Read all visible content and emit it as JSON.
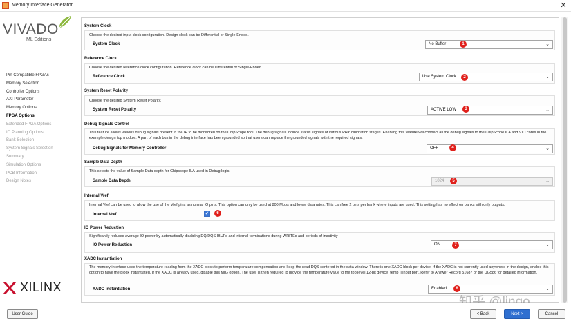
{
  "window": {
    "title": "Memory Interface Generator",
    "close_glyph": "✕"
  },
  "brand": {
    "product": "VIVADO",
    "edition": "ML Editions",
    "vendor": "XILINX"
  },
  "steps": [
    {
      "label": "Pin Compatible FPGAs",
      "state": "done"
    },
    {
      "label": "Memory Selection",
      "state": "done"
    },
    {
      "label": "Controller Options",
      "state": "done"
    },
    {
      "label": "AXI Parameter",
      "state": "done"
    },
    {
      "label": "Memory Options",
      "state": "done"
    },
    {
      "label": "FPGA Options",
      "state": "current"
    },
    {
      "label": "Extended FPGA Options",
      "state": "future"
    },
    {
      "label": "IO Planning Options",
      "state": "future"
    },
    {
      "label": "Bank Selection",
      "state": "future"
    },
    {
      "label": "System Signals Selection",
      "state": "future"
    },
    {
      "label": "Summary",
      "state": "future"
    },
    {
      "label": "Simulation Options",
      "state": "future"
    },
    {
      "label": "PCB Information",
      "state": "future"
    },
    {
      "label": "Design Notes",
      "state": "future"
    }
  ],
  "sections": {
    "system_clock": {
      "title": "System Clock",
      "desc": "Choose the desired input clock configuration. Design clock can be Differential or Single-Ended.",
      "label": "System Clock",
      "value": "No Buffer",
      "badge": "1"
    },
    "reference_clock": {
      "title": "Reference Clock",
      "desc": "Choose the desired reference clock configuration. Reference clock can be Differential or Single-Ended.",
      "label": "Reference Clock",
      "value": "Use System Clock",
      "badge": "2"
    },
    "reset_polarity": {
      "title": "System Reset Polarity",
      "desc": "Choose the desired System Reset Polarity.",
      "label": "System Reset Polarity",
      "value": "ACTIVE LOW",
      "badge": "3"
    },
    "debug": {
      "title": "Debug Signals Control",
      "desc": "This feature allows various debug signals present in the IP to be monitored on the ChipScope tool. The debug signals include status signals of various PHY calibration stages. Enabling this feature will connect all the debug signals to the ChipScope ILA and VIO cores in the example design top module. A part of each bus in the debug interface has been grounded so that users can replace the grounded signals with the required signals.",
      "label": "Debug Signals for Memory Controller",
      "value": "OFF",
      "badge": "4"
    },
    "sample_depth": {
      "title": "Sample Data Depth",
      "desc": "This selects the value of Sample Data depth for Chipscope ILA used in Debug logic.",
      "label": "Sample Data Depth",
      "value": "1024",
      "badge": "5"
    },
    "internal_vref": {
      "title": "Internal Vref",
      "desc": "Internal Vref can be used to allow the use of the Vref pins as normal IO pins. This option can only be used at 800 Mbps and lower data rates. This can free 2 pins per bank where inputs are used. This setting has no effect on banks with only outputs.",
      "label": "Internal Vref",
      "check_glyph": "✓",
      "badge": "6"
    },
    "io_power": {
      "title": "IO Power Reduction",
      "desc": "Significantly reduces average IO power by automatically disabling DQ/DQS IBUFs and internal terminations during WRITEs and periods of inactivity",
      "label": "IO Power Reduction",
      "value": "ON",
      "badge": "7"
    },
    "xadc": {
      "title": "XADC Instantiation",
      "desc": "The memory interface uses the temperature reading from the XADC block to perform temperature compensation and keep the read DQS centered in the data window. There is one XADC block per device. If the XADC is not currently used anywhere in the design, enable this option to have the block instantiated. If the XADC is already used, disable this MIG option. The user is then required to provide the temperature value to the top level 12-bit device_temp_i input port. Refer to Answer Record 51687 or the UG586 for detailed information.",
      "label": "XADC Instantiation",
      "value": "Enabled",
      "badge": "8"
    }
  },
  "buttons": {
    "user_guide": "User Guide",
    "back": "< Back",
    "next": "Next >",
    "cancel": "Cancel"
  },
  "watermark": "知乎 @lingo",
  "dropdown_glyph": "⌄",
  "colors": {
    "badge": "#e0201b",
    "primary_button": "#2f6fd0",
    "checkbox": "#3b78d8"
  }
}
